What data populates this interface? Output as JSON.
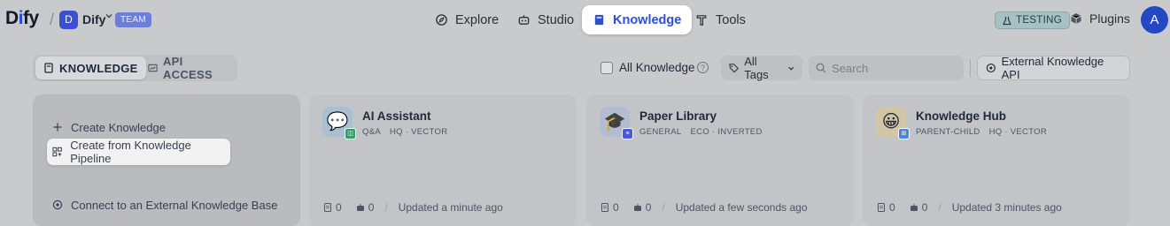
{
  "header": {
    "logo": {
      "part1": "D",
      "part2": "i",
      "part3": "fy"
    },
    "workspace": {
      "initial": "D",
      "name": "Dify",
      "badge": "TEAM"
    },
    "nav": [
      {
        "label": "Explore",
        "icon": "compass-icon"
      },
      {
        "label": "Studio",
        "icon": "robot-icon"
      },
      {
        "label": "Knowledge",
        "icon": "book-icon",
        "active": true
      },
      {
        "label": "Tools",
        "icon": "hammer-icon"
      }
    ],
    "testing_badge": "TESTING",
    "plugins_label": "Plugins",
    "user_initial": "A"
  },
  "toolbar": {
    "tabs": [
      {
        "label": "KNOWLEDGE",
        "active": true
      },
      {
        "label": "API ACCESS",
        "active": false
      }
    ],
    "all_knowledge_label": "All Knowledge",
    "all_knowledge_checked": false,
    "tags_label": "All Tags",
    "search_placeholder": "Search",
    "external_api_label": "External Knowledge API"
  },
  "create_card": {
    "items": [
      {
        "label": "Create Knowledge"
      },
      {
        "label": "Create from Knowledge Pipeline"
      },
      {
        "label": "Connect to an External Knowledge Base"
      }
    ]
  },
  "knowledge_cards": [
    {
      "name": "AI Assistant",
      "emoji": "💬",
      "tags": [
        "Q&A",
        "HQ · VECTOR"
      ],
      "docs": "0",
      "apps": "0",
      "updated": "Updated a minute ago",
      "icon_bg": "#a9bfd2",
      "badge_color": "#3a9b6a"
    },
    {
      "name": "Paper Library",
      "emoji": "🎓",
      "tags": [
        "GENERAL",
        "ECO · INVERTED"
      ],
      "docs": "0",
      "apps": "0",
      "updated": "Updated a few seconds ago",
      "icon_bg": "#b4bdd0",
      "badge_color": "#4a59d6"
    },
    {
      "name": "Knowledge Hub",
      "emoji": "😀",
      "tags": [
        "PARENT-CHILD",
        "HQ · VECTOR"
      ],
      "docs": "0",
      "apps": "0",
      "updated": "Updated 3 minutes ago",
      "icon_bg": "#d3c6a7",
      "badge_color": "#4b83d6"
    }
  ]
}
